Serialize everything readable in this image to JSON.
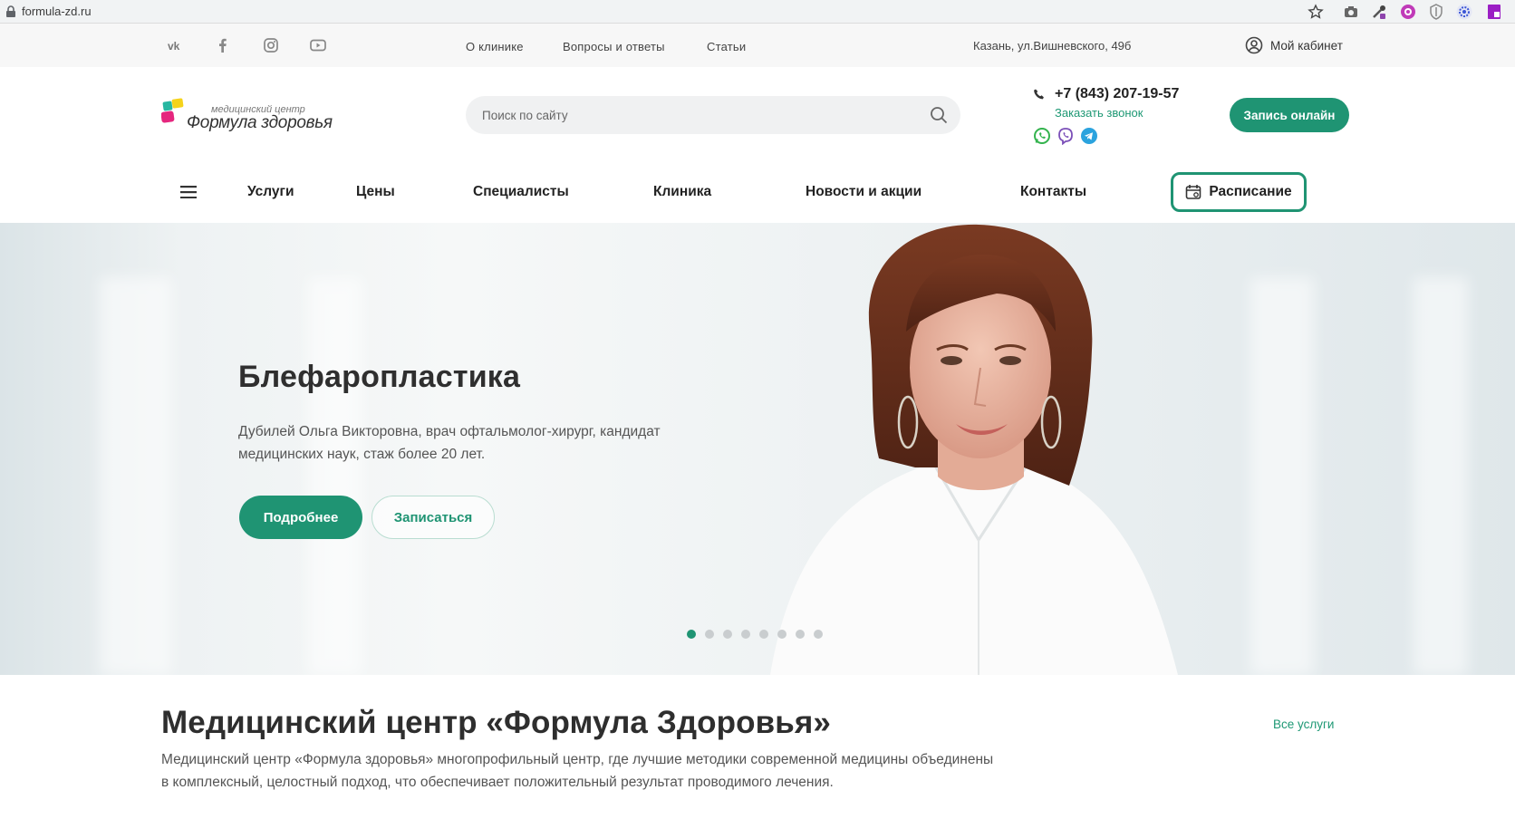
{
  "browser": {
    "url": "formula-zd.ru",
    "icons": [
      "star-icon",
      "camera-icon",
      "eyedropper-extension-icon",
      "record-extension-icon",
      "shield-extension-icon",
      "gear-extension-icon",
      "pdf-extension-icon"
    ]
  },
  "topbar": {
    "social": [
      "vk-icon",
      "facebook-icon",
      "instagram-icon",
      "youtube-icon"
    ],
    "links": [
      "О клинике",
      "Вопросы и ответы",
      "Статьи"
    ],
    "address": "Казань, ул.Вишневского, 49б",
    "cabinet": "Мой кабинет"
  },
  "header": {
    "logo_small": "медицинский центр",
    "logo_big": "Формула здоровья",
    "search_placeholder": "Поиск по сайту",
    "phone": "+7 (843) 207-19-57",
    "callback": "Заказать звонок",
    "messengers": [
      "whatsapp-icon",
      "viber-icon",
      "telegram-icon"
    ],
    "book_button": "Запись онлайн"
  },
  "nav": {
    "items": [
      "Услуги",
      "Цены",
      "Специалисты",
      "Клиника",
      "Новости и акции",
      "Контакты"
    ],
    "schedule": "Расписание"
  },
  "hero": {
    "title": "Блефаропластика",
    "text": "Дубилей Ольга Викторовна, врач офтальмолог-хирург, кандидат медицинских наук, стаж более 20 лет.",
    "btn_more": "Подробнее",
    "btn_signup": "Записаться",
    "slides_total": 8,
    "active_slide": 1
  },
  "about": {
    "title": "Медицинский центр «Формула Здоровья»",
    "all_services": "Все услуги",
    "text": "Медицинский центр «Формула здоровья» многопрофильный центр, где лучшие методики современной медицины объединены в комплексный, целостный подход, что обеспечивает положительный результат проводимого лечения."
  },
  "colors": {
    "accent": "#1f9473",
    "text": "#2b2b2b"
  }
}
